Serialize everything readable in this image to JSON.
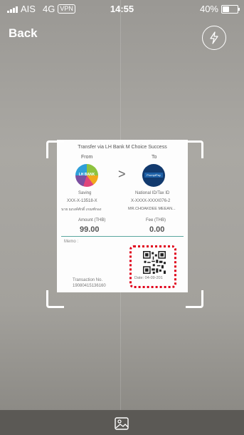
{
  "status_bar": {
    "carrier": "AIS",
    "network": "4G",
    "vpn": "VPN",
    "time": "14:55",
    "battery_percent": "40%",
    "battery_level": 0.4
  },
  "nav": {
    "back_label": "Back",
    "flash_icon": "lightning-icon"
  },
  "receipt": {
    "title": "Transfer via LH Bank M Choice Success",
    "from_label": "From",
    "to_label": "To",
    "from_bank_logo_text": "LH BANK",
    "to_bank_logo_text": "PromptPay",
    "from_account_type": "Saving",
    "from_account_number": "XXX-X-13518-X",
    "from_account_name": "นาย ณรงค์ศักดิ์ เกณฑ์กอง",
    "to_account_type": "National ID/Tax ID",
    "to_account_number": "X-XXXX-XXXX076-2",
    "to_account_name": "MR.CHOAKDEE MEEAN...",
    "amount_label": "Amount (THB)",
    "amount_value": "99.00",
    "fee_label": "Fee (THB)",
    "fee_value": "0.00",
    "memo_label": "Memo :",
    "transaction_label": "Transaction No.",
    "transaction_value": "19080415136160",
    "date_text": "Date: 04-09-201"
  },
  "bottom": {
    "gallery_icon": "gallery-icon"
  },
  "colors": {
    "highlight": "#e0001a",
    "divider": "#5aa7a0"
  }
}
